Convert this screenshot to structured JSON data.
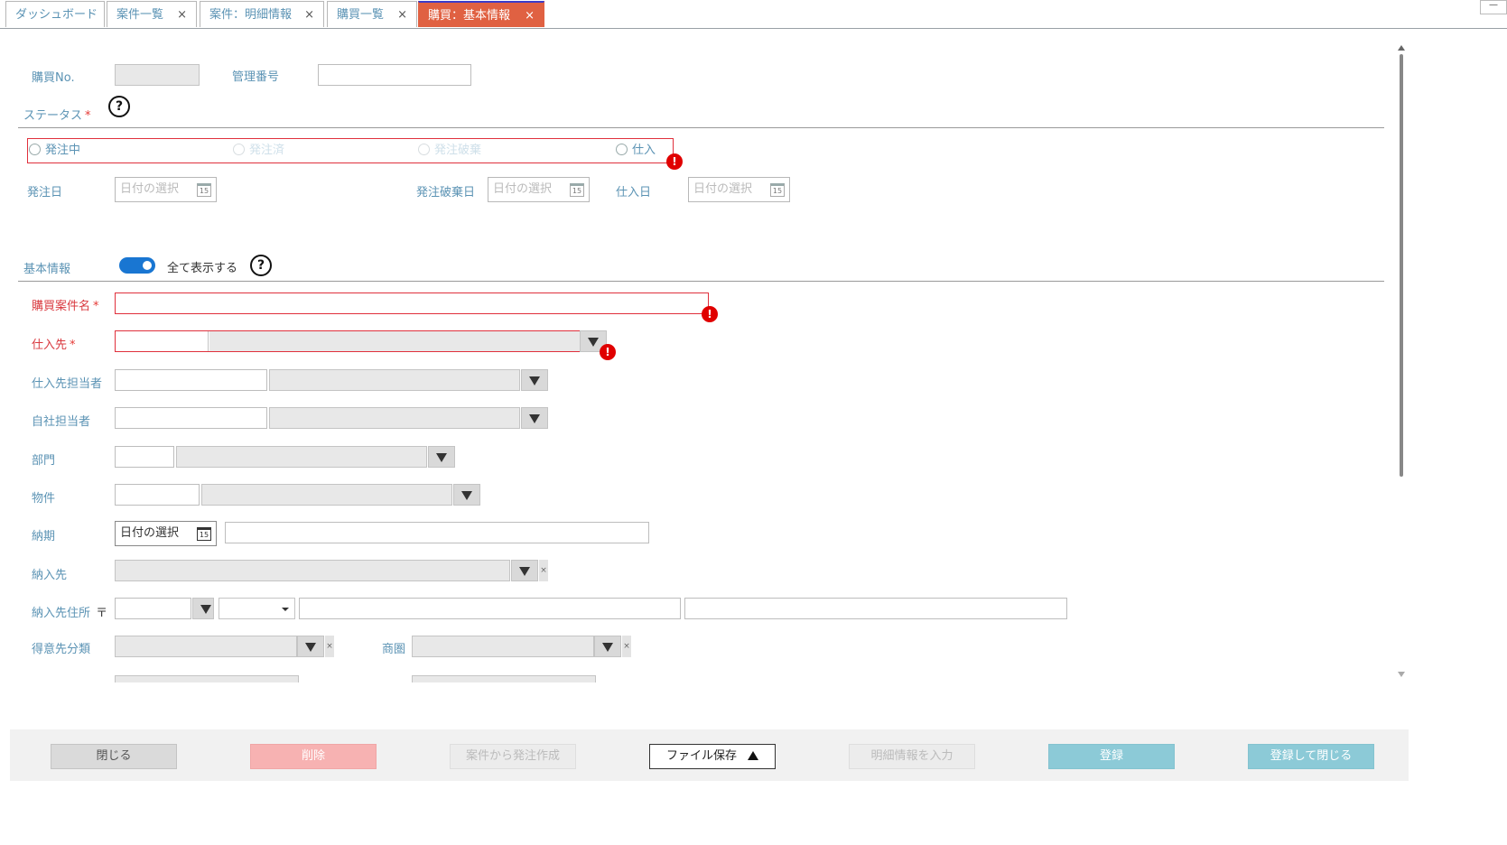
{
  "tabs": [
    {
      "label": "ダッシュボード",
      "close": ""
    },
    {
      "label": "案件一覧",
      "close": "×"
    },
    {
      "label": "案件：明細情報",
      "close": "×"
    },
    {
      "label": "購買一覧",
      "close": "×"
    },
    {
      "label": "購買：基本情報",
      "close": "×"
    }
  ],
  "window_min": "—",
  "form": {
    "purchase_no_label": "購買No.",
    "mgmt_no_label": "管理番号",
    "status_label": "ステータス",
    "required_mark": "*",
    "help_glyph": "?",
    "error_glyph": "!",
    "status_options": [
      "発注中",
      "発注済",
      "発注破棄",
      "仕入"
    ],
    "order_date_label": "発注日",
    "cancel_date_label": "発注破棄日",
    "purchase_date_label": "仕入日",
    "date_placeholder": "日付の選択",
    "cal_day": "15",
    "basic_info_label": "基本情報",
    "show_all_label": "全て表示する",
    "case_name_label": "購買案件名",
    "supplier_label": "仕入先",
    "supplier_contact_label": "仕入先担当者",
    "own_contact_label": "自社担当者",
    "department_label": "部門",
    "property_label": "物件",
    "delivery_date_label": "納期",
    "delivery_to_label": "納入先",
    "delivery_address_label": "納入先住所",
    "postal_mark": "〒",
    "customer_class_label": "得意先分類",
    "trade_area_label": "商圏",
    "clear_glyph": "×"
  },
  "footer": {
    "close": "閉じる",
    "delete": "削除",
    "create_order": "案件から発注作成",
    "file_save": "ファイル保存",
    "enter_detail": "明細情報を入力",
    "register": "登録",
    "register_close": "登録して閉じる"
  }
}
